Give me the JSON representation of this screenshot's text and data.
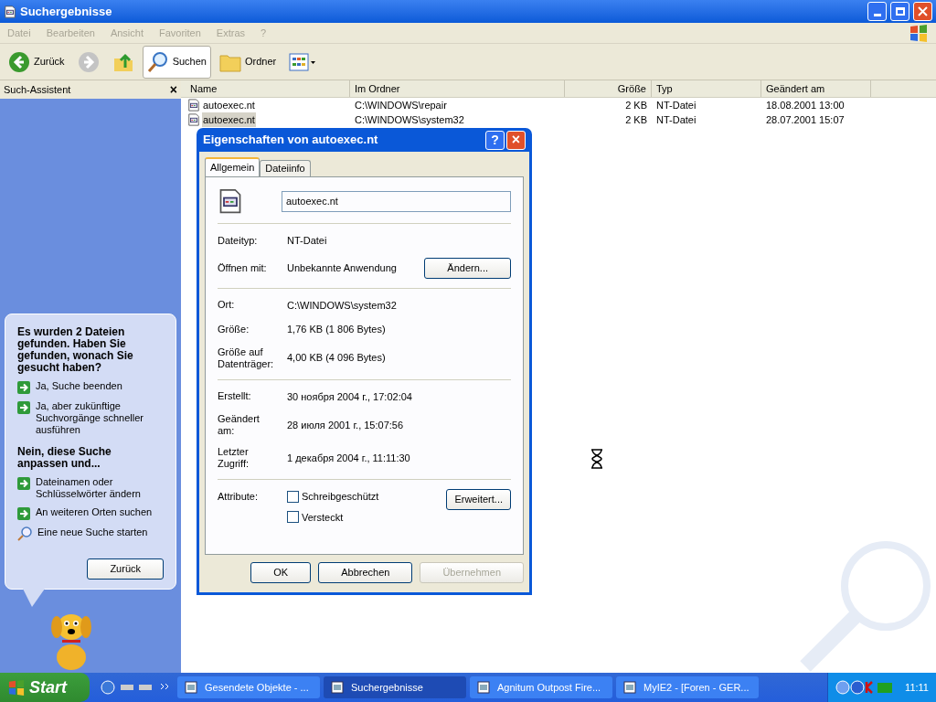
{
  "window": {
    "title": "Suchergebnisse"
  },
  "menu": [
    "Datei",
    "Bearbeiten",
    "Ansicht",
    "Favoriten",
    "Extras",
    "?"
  ],
  "toolbar": [
    {
      "kind": "back",
      "label": "Zurück",
      "selected": false
    },
    {
      "kind": "forward",
      "selected": false
    },
    {
      "kind": "up",
      "selected": false
    },
    {
      "kind": "search",
      "label": "Suchen",
      "selected": true
    },
    {
      "kind": "folders",
      "label": "Ordner",
      "selected": false
    },
    {
      "kind": "views",
      "selected": false
    }
  ],
  "side_panel": {
    "title": "Such-Assistent",
    "close": "×",
    "heading": "Es wurden 2 Dateien gefunden. Haben Sie gefunden, wonach Sie gesucht haben?",
    "links": [
      {
        "kind": "arrow",
        "label": "Ja, Suche beenden"
      },
      {
        "kind": "arrow",
        "label": "Ja, aber zukünftige Suchvorgänge schneller ausführen"
      },
      {
        "kind": "heading",
        "label": "Nein, diese Suche anpassen und..."
      },
      {
        "kind": "arrow",
        "label": "Dateinamen oder Schlüsselwörter ändern"
      },
      {
        "kind": "arrow",
        "label": "An weiteren Orten suchen"
      },
      {
        "kind": "search",
        "label": "Eine neue Suche starten"
      }
    ],
    "back_button": "Zurück"
  },
  "table": {
    "columns": [
      "Name",
      "Im Ordner",
      "Größe",
      "Typ",
      "Geändert am"
    ],
    "rows": [
      {
        "name": "autoexec.nt",
        "folder": "C:\\WINDOWS\\repair",
        "size": "2 KB",
        "type": "NT-Datei",
        "modified": "18.08.2001 13:00",
        "selected": false
      },
      {
        "name": "autoexec.nt",
        "folder": "C:\\WINDOWS\\system32",
        "size": "2 KB",
        "type": "NT-Datei",
        "modified": "28.07.2001 15:07",
        "selected": true
      }
    ]
  },
  "dialog": {
    "title": "Eigenschaften von autoexec.nt",
    "help": "?",
    "close": "×",
    "tabs": [
      {
        "label": "Allgemein",
        "selected": true
      },
      {
        "label": "Dateiinfo",
        "selected": false
      }
    ],
    "filename": "autoexec.nt",
    "groups": [
      [
        {
          "label": "Dateityp:",
          "value": "NT-Datei"
        },
        {
          "label": "Öffnen mit:",
          "value": "Unbekannte Anwendung",
          "button": "Ändern..."
        }
      ],
      [
        {
          "label": "Ort:",
          "value": "C:\\WINDOWS\\system32"
        },
        {
          "label": "Größe:",
          "value": "1,76 KB (1 806 Bytes)"
        },
        {
          "label": "Größe auf Datenträger:",
          "value": "4,00 KB (4 096 Bytes)"
        }
      ],
      [
        {
          "label": "Erstellt:",
          "value": "30 ноября 2004 г., 17:02:04"
        },
        {
          "label": "Geändert am:",
          "value": "28 июля 2001 г., 15:07:56"
        },
        {
          "label": "Letzter Zugriff:",
          "value": "1 декабря 2004 г., 11:11:30"
        }
      ]
    ],
    "attributes_label": "Attribute:",
    "attributes": [
      {
        "label": "Schreibgeschützt",
        "checked": false
      },
      {
        "label": "Versteckt",
        "checked": false
      }
    ],
    "advanced_button": "Erweitert...",
    "buttons": [
      {
        "label": "OK",
        "disabled": false
      },
      {
        "label": "Abbrechen",
        "disabled": false
      },
      {
        "label": "Übernehmen",
        "disabled": true
      }
    ]
  },
  "taskbar": {
    "start": "Start",
    "tasks": [
      {
        "label": "Gesendete Objekte - ...",
        "selected": false
      },
      {
        "label": "Suchergebnisse",
        "selected": true
      },
      {
        "label": "Agnitum Outpost Fire...",
        "selected": false
      },
      {
        "label": "MyIE2 - [Foren - GER...",
        "selected": false
      }
    ],
    "clock": "11:11"
  }
}
